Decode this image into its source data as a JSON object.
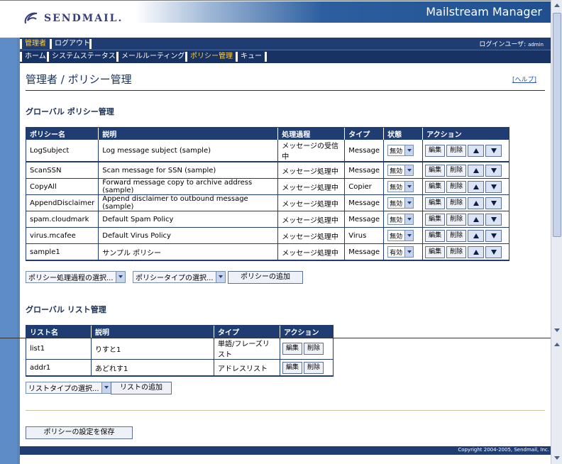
{
  "header": {
    "logo_text": "SENDMAIL.",
    "app_title": "Mailstream Manager"
  },
  "nav1": {
    "admin": "管理者",
    "logout": "ログアウト",
    "login_label": "ログインユーザ: ",
    "login_user": "admin"
  },
  "nav2": {
    "home": "ホーム",
    "system_status": "システムステータス",
    "mail_routing": "メールルーティング",
    "policy_mgmt": "ポリシー管理",
    "queue": "キュー"
  },
  "page": {
    "title": "管理者 / ポリシー管理",
    "help": "[ヘルプ]"
  },
  "policy_section": {
    "title": "グローバル ポリシー管理",
    "headers": [
      "ポリシー名",
      "説明",
      "処理過程",
      "タイプ",
      "状態",
      "アクション"
    ],
    "edit_label": "編集",
    "delete_label": "削除",
    "rows": [
      {
        "name": "LogSubject",
        "desc": "Log message subject (sample)",
        "stage": "メッセージの受信中",
        "type": "Message",
        "status": "無効"
      },
      {
        "name": "ScanSSN",
        "desc": "Scan message for SSN (sample)",
        "stage": "メッセージ処理中",
        "type": "Message",
        "status": "無効"
      },
      {
        "name": "CopyAll",
        "desc": "Forward message copy to archive address (sample)",
        "stage": "メッセージ処理中",
        "type": "Copier",
        "status": "無効"
      },
      {
        "name": "AppendDisclaimer",
        "desc": "Append disclaimer to outbound message (sample)",
        "stage": "メッセージ処理中",
        "type": "Message",
        "status": "無効"
      },
      {
        "name": "spam.cloudmark",
        "desc": "Default Spam Policy",
        "stage": "メッセージ処理中",
        "type": "Message",
        "status": "無効"
      },
      {
        "name": "virus.mcafee",
        "desc": "Default Virus Policy",
        "stage": "メッセージ処理中",
        "type": "Virus",
        "status": "無効"
      },
      {
        "name": "sample1",
        "desc": "サンプル ポリシー",
        "stage": "メッセージ処理中",
        "type": "Message",
        "status": "有効"
      }
    ],
    "stage_select": "ポリシー処理過程の選択...",
    "type_select": "ポリシータイプの選択...",
    "add_button": "ポリシーの追加"
  },
  "list_section": {
    "title": "グローバル リスト管理",
    "headers": [
      "リスト名",
      "説明",
      "タイプ",
      "アクション"
    ],
    "rows": [
      {
        "name": "list1",
        "desc": "りすと1",
        "type": "単語/フレーズリスト"
      },
      {
        "name": "addr1",
        "desc": "あどれす1",
        "type": "アドレスリスト"
      }
    ],
    "type_select": "リストタイプの選択...",
    "add_button": "リストの追加"
  },
  "save_button": "ポリシーの設定を保存",
  "footer": {
    "copyright": "Copyright 2004-2005, Sendmail, Inc."
  }
}
